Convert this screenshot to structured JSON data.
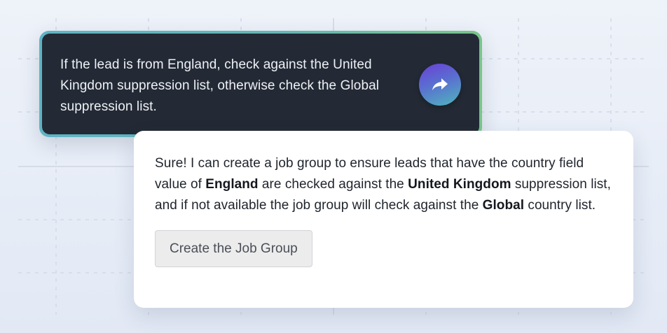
{
  "prompt": {
    "text": "If the lead is from England, check against the United Kingdom suppression list, otherwise check the Global suppression list.",
    "send_icon": "share-arrow-icon"
  },
  "response": {
    "segments": [
      "Sure! I can create a job group to ensure leads that have the country field value of ",
      "England",
      " are checked against the ",
      "United Kingdom",
      " suppression list, and if not available the job group will check against the ",
      "Global",
      " country list."
    ],
    "button_label": "Create the Job Group"
  },
  "colors": {
    "prompt_background": "#232a35",
    "prompt_border_start": "#5fb3c4",
    "prompt_border_end": "#78c58a",
    "send_button_start": "#6a3fd6",
    "send_button_end": "#4fb6bd",
    "page_background": "#e9eef7"
  }
}
